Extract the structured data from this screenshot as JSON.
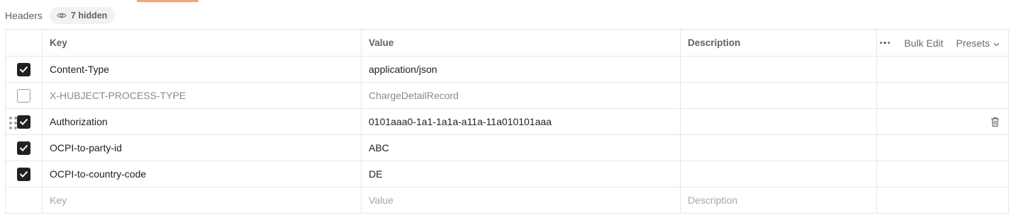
{
  "section": {
    "title": "Headers",
    "hidden_count": "7 hidden"
  },
  "table": {
    "columns": {
      "key": "Key",
      "value": "Value",
      "description": "Description"
    },
    "bulk_edit": "Bulk Edit",
    "presets": "Presets",
    "rows": [
      {
        "enabled": true,
        "key": "Content-Type",
        "value": "application/json",
        "description": ""
      },
      {
        "enabled": false,
        "key": "X-HUBJECT-PROCESS-TYPE",
        "value": "ChargeDetailRecord",
        "description": ""
      },
      {
        "enabled": true,
        "key": "Authorization",
        "value": "0101aaa0-1a1-1a1a-a11a-11a010101aaa",
        "description": ""
      },
      {
        "enabled": true,
        "key": "OCPI-to-party-id",
        "value": "ABC",
        "description": ""
      },
      {
        "enabled": true,
        "key": "OCPI-to-country-code",
        "value": "DE",
        "description": ""
      }
    ],
    "new_row": {
      "key_placeholder": "Key",
      "value_placeholder": "Value",
      "description_placeholder": "Description"
    }
  },
  "icons": {
    "hidden": "eye-icon",
    "more": "more-horizontal-icon",
    "presets": "chevron-down-icon",
    "delete": "trash-icon",
    "drag": "drag-handle-icon",
    "check": "checkmark-icon"
  },
  "colors": {
    "accent": "#f4a37d",
    "checkbox_on": "#212121",
    "border": "#e6e6e6"
  }
}
